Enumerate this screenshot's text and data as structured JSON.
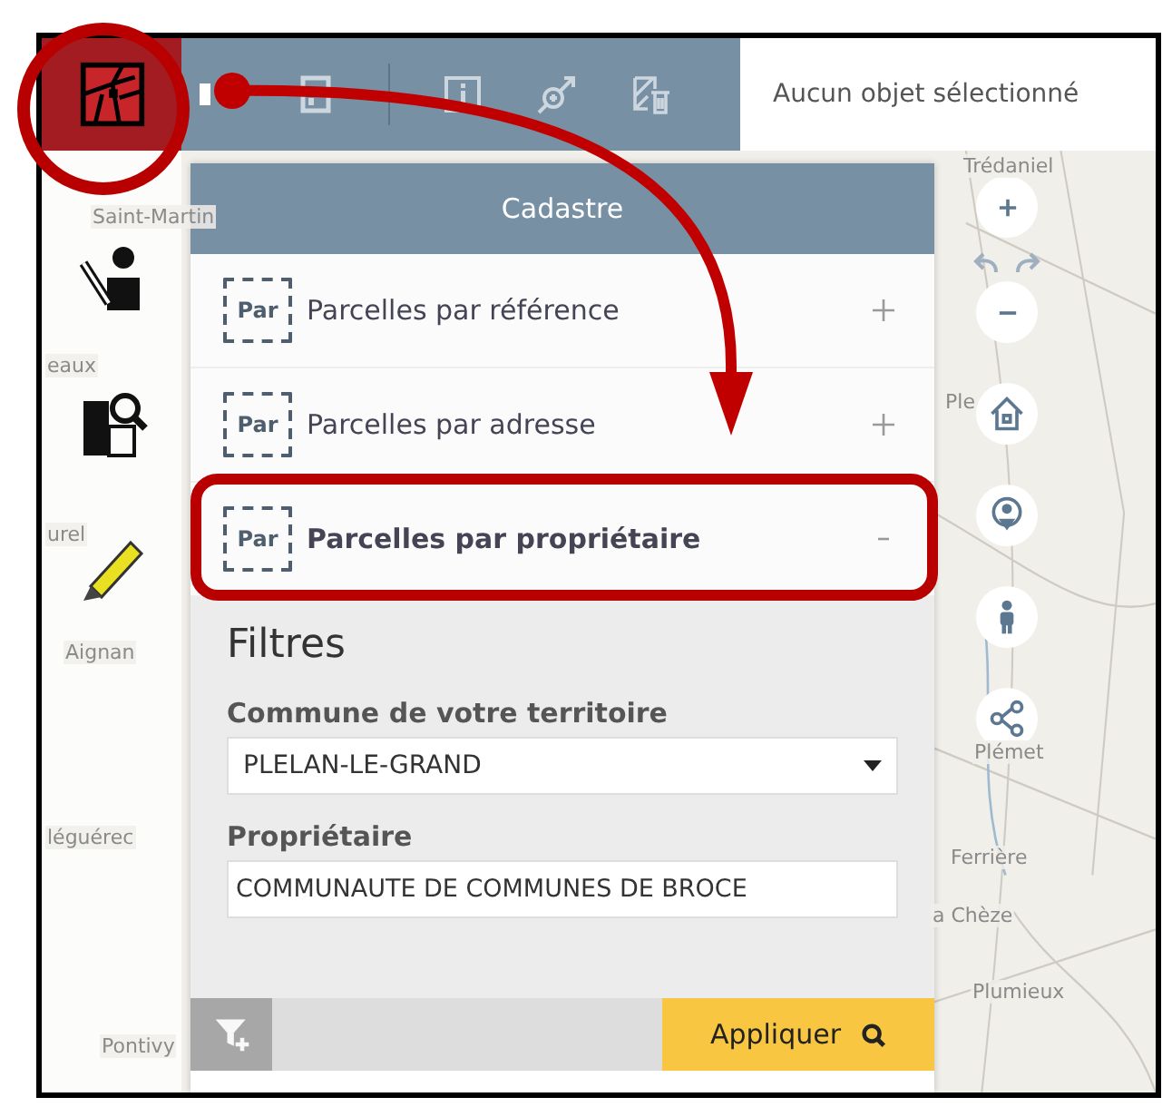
{
  "toolbar": {
    "status": "Aucun objet sélectionné"
  },
  "panel": {
    "title": "Cadastre",
    "sections": [
      {
        "badge": "Par",
        "label": "Parcelles par référence",
        "expanded": false
      },
      {
        "badge": "Par",
        "label": "Parcelles par adresse",
        "expanded": false
      },
      {
        "badge": "Par",
        "label": "Parcelles par propriétaire",
        "expanded": true
      }
    ],
    "filters": {
      "title": "Filtres",
      "commune": {
        "label": "Commune de votre territoire",
        "value": "PLELAN-LE-GRAND"
      },
      "owner": {
        "label": "Propriétaire",
        "value": "COMMUNAUTE DE COMMUNES DE BROCE"
      }
    },
    "apply": "Appliquer"
  },
  "map": {
    "labels": [
      "Trédaniel",
      "Saint-Martin",
      "eaux",
      "Ple",
      "Plémet",
      "Ferrière",
      "a Chèze",
      "Plumieux",
      "Aignan",
      "léguérec",
      "Pontivy",
      "urel"
    ]
  }
}
